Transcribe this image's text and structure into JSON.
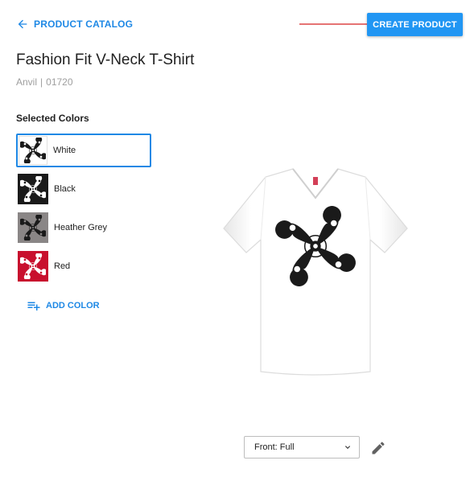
{
  "header": {
    "back_label": "PRODUCT CATALOG",
    "create_label": "CREATE PRODUCT"
  },
  "product": {
    "title": "Fashion Fit V-Neck T-Shirt",
    "brand": "Anvil",
    "separator": "|",
    "sku": "01720"
  },
  "colors": {
    "heading": "Selected Colors",
    "items": [
      {
        "label": "White",
        "swatch": "#ffffff",
        "mark": "#1a1a1a",
        "selected": true
      },
      {
        "label": "Black",
        "swatch": "#1a1a1a",
        "mark": "#ffffff",
        "selected": false
      },
      {
        "label": "Heather Grey",
        "swatch": "#8a8686",
        "mark": "#1a1a1a",
        "selected": false
      },
      {
        "label": "Red",
        "swatch": "#c8102e",
        "mark": "#ffffff",
        "selected": false
      }
    ],
    "add_label": "ADD COLOR"
  },
  "preview": {
    "view_selected": "Front: Full",
    "shirt_color": "#ffffff",
    "print_color": "#1a1a1a"
  },
  "theme": {
    "accent": "#2196f3",
    "annotation": "#e57373"
  }
}
